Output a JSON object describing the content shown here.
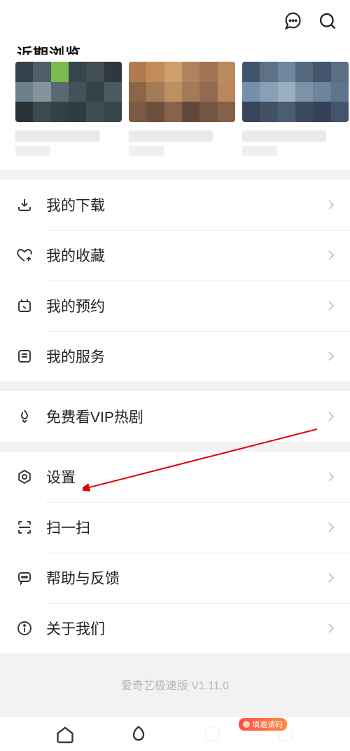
{
  "header": {
    "chat_icon": "chat-bubble-icon",
    "search_icon": "search-icon"
  },
  "recent_section": {
    "title": "近期浏览"
  },
  "menu_group_1": [
    {
      "icon": "download-icon",
      "label": "我的下载"
    },
    {
      "icon": "heart-add-icon",
      "label": "我的收藏"
    },
    {
      "icon": "calendar-icon",
      "label": "我的预约"
    },
    {
      "icon": "list-box-icon",
      "label": "我的服务"
    }
  ],
  "menu_group_2": [
    {
      "icon": "flame-icon",
      "label": "免费看VIP热剧"
    }
  ],
  "menu_group_3": [
    {
      "icon": "gear-hex-icon",
      "label": "设置"
    },
    {
      "icon": "scan-icon",
      "label": "扫一扫"
    },
    {
      "icon": "help-chat-icon",
      "label": "帮助与反馈"
    },
    {
      "icon": "info-icon",
      "label": "关于我们"
    }
  ],
  "footer": {
    "version_text": "爱奇艺极速版 V1.11.0"
  },
  "bottom_badge": {
    "text": "填邀请码"
  }
}
